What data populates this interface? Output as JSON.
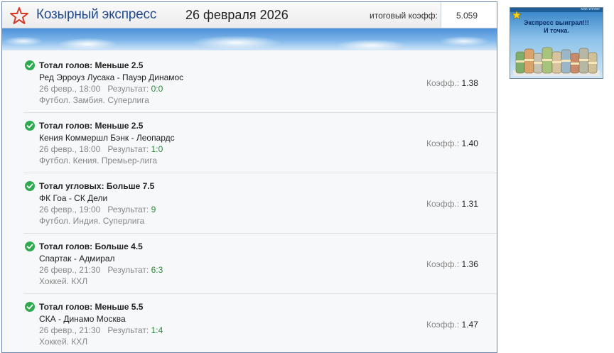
{
  "header": {
    "brand": "Козырный экспресс",
    "date": "26 февраля 2026",
    "total_label": "итоговый коэфф:",
    "total_value": "5.059",
    "star_icon": "star-outline-red"
  },
  "colors": {
    "accent": "#d63a2a",
    "brand": "#234a8a",
    "success": "#2eaa4f",
    "result": "#2a8a3a"
  },
  "labels": {
    "result": "Результат:",
    "odds": "Коэфф.:"
  },
  "bets": [
    {
      "title": "Тотал голов: Меньше 2.5",
      "match": "Ред Эрроуз Лусака - Пауэр Динамос",
      "datetime": "26 февр., 18:00",
      "result": "0:0",
      "league": "Футбол. Замбия. Суперлига",
      "odds": "1.38"
    },
    {
      "title": "Тотал голов: Меньше 2.5",
      "match": "Кения Коммершл Бэнк - Леопардс",
      "datetime": "26 февр., 18:00",
      "result": "1:0",
      "league": "Футбол. Кения. Премьер-лига",
      "odds": "1.40"
    },
    {
      "title": "Тотал угловых: Больше 7.5",
      "match": "ФК Гоа - СК Дели",
      "datetime": "26 февр., 19:00",
      "result": "9",
      "league": "Футбол. Индия. Суперлига",
      "odds": "1.31"
    },
    {
      "title": "Тотал голов: Больше 4.5",
      "match": "Спартак - Адмирал",
      "datetime": "26 февр., 21:30",
      "result": "6:3",
      "league": "Хоккей. КХЛ",
      "odds": "1.36"
    },
    {
      "title": "Тотал голов: Меньше 5.5",
      "match": "СКА - Динамо Москва",
      "datetime": "26 февр., 21:30",
      "result": "1:4",
      "league": "Хоккей. КХЛ",
      "odds": "1.47"
    }
  ],
  "promo": {
    "line1": "Экспресс выиграл!!!",
    "line2": "И точка.",
    "small_caption": "Max Winner",
    "icons": [
      "star-icon",
      "money-rolls-image"
    ]
  }
}
